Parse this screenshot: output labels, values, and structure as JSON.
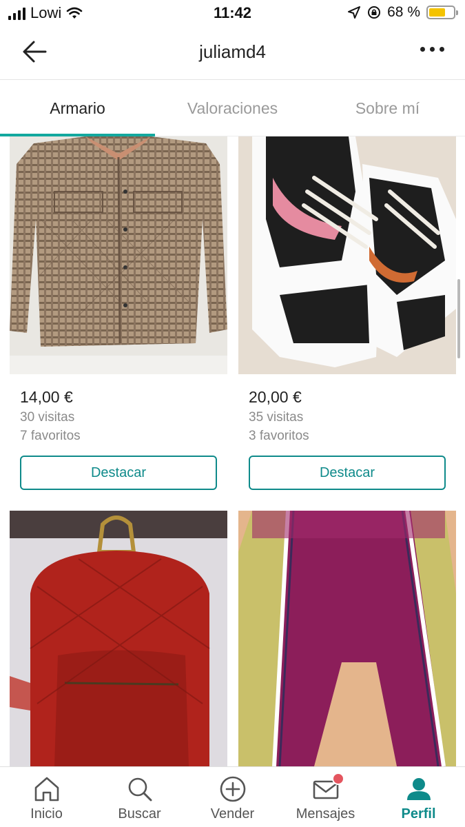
{
  "status_bar": {
    "carrier": "Lowi",
    "time": "11:42",
    "battery": "68 %",
    "battery_level": 0.68
  },
  "header": {
    "title": "juliamd4"
  },
  "tabs": [
    {
      "label": "Armario",
      "active": true
    },
    {
      "label": "Valoraciones",
      "active": false
    },
    {
      "label": "Sobre mí",
      "active": false
    }
  ],
  "items": [
    {
      "price": "14,00 €",
      "views": "30 visitas",
      "favorites": "7 favoritos",
      "button": "Destacar"
    },
    {
      "price": "20,00 €",
      "views": "35 visitas",
      "favorites": "3 favoritos",
      "button": "Destacar"
    }
  ],
  "bottom_nav": [
    {
      "label": "Inicio",
      "icon": "home-icon"
    },
    {
      "label": "Buscar",
      "icon": "search-icon"
    },
    {
      "label": "Vender",
      "icon": "plus-circle-icon"
    },
    {
      "label": "Mensajes",
      "icon": "mail-icon"
    },
    {
      "label": "Perfil",
      "icon": "profile-icon",
      "active": true
    }
  ],
  "colors": {
    "accent": "#0e8a8a",
    "tab_indicator": "#13a89e",
    "badge": "#e4555f"
  }
}
